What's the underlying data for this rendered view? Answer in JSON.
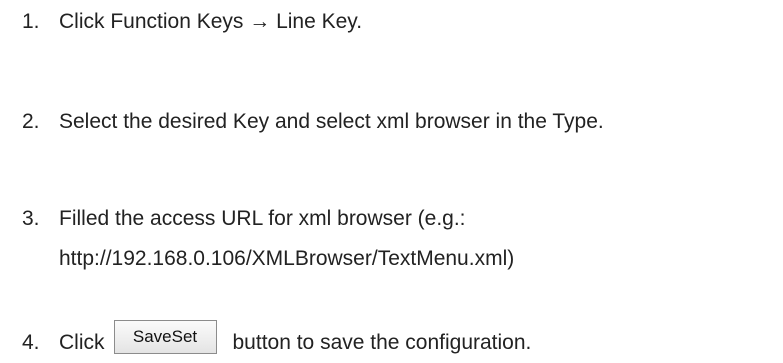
{
  "steps": [
    {
      "number": "1.",
      "lines": [
        "Click Function Keys → Line Key."
      ]
    },
    {
      "number": "2.",
      "lines": [
        "Select the desired Key and select xml browser in the Type."
      ]
    },
    {
      "number": "3.",
      "lines": [
        "Filled the access URL for xml browser (e.g.:",
        "http://192.168.0.106/XMLBrowser/TextMenu.xml)"
      ]
    },
    {
      "number": "4.",
      "prefix": "Click",
      "button_label": "SaveSet",
      "suffix": "button to save the configuration."
    }
  ]
}
